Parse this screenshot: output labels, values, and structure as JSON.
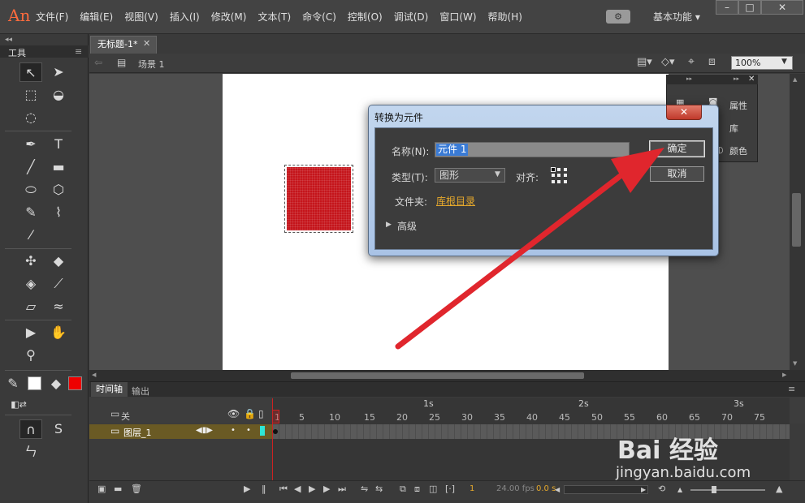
{
  "app": {
    "logo": "An"
  },
  "menu": {
    "items": [
      "文件(F)",
      "编辑(E)",
      "视图(V)",
      "插入(I)",
      "修改(M)",
      "文本(T)",
      "命令(C)",
      "控制(O)",
      "调试(D)",
      "窗口(W)",
      "帮助(H)"
    ],
    "workspace": "基本功能"
  },
  "tools": {
    "title": "工具"
  },
  "document": {
    "tab_title": "无标题-1*",
    "scene": "场景 1",
    "zoom": "100%"
  },
  "side_panel": {
    "items": [
      "属性",
      "库",
      "颜色"
    ]
  },
  "dialog": {
    "title": "转换为元件",
    "name_label": "名称(N):",
    "name_value": "元件 1",
    "type_label": "类型(T):",
    "type_value": "图形",
    "align_label": "对齐:",
    "folder_label": "文件夹:",
    "folder_value": "库根目录",
    "advanced_label": "高级",
    "ok_label": "确定",
    "cancel_label": "取消"
  },
  "timeline": {
    "tabs": [
      "时间轴",
      "输出"
    ],
    "header_label": "关",
    "seconds": [
      "1s",
      "2s",
      "3s"
    ],
    "frame_numbers": [
      "1",
      "5",
      "10",
      "15",
      "20",
      "25",
      "30",
      "35",
      "40",
      "45",
      "50",
      "55",
      "60",
      "65",
      "70",
      "75"
    ],
    "layer_name": "图层_1",
    "current_frame": "1",
    "fps": "24.00 fps",
    "elapsed": "0.0 s"
  },
  "watermark": {
    "top": "Bai 经验",
    "bottom": "jingyan.baidu.com"
  },
  "colors": {
    "accent_red": "#e0262d",
    "fill_red": "#c5151b",
    "link_orange": "#e6a92c"
  }
}
